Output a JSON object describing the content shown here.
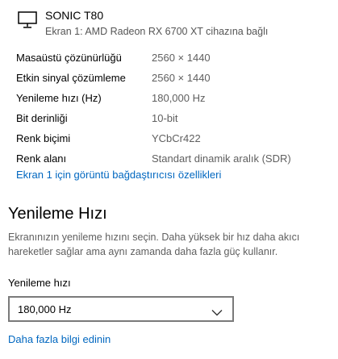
{
  "display": {
    "icon": "monitor-icon",
    "name": "SONIC T80",
    "subtitle": "Ekran 1: AMD Radeon RX 6700 XT cihazına bağlı"
  },
  "info_rows": [
    {
      "label": "Masaüstü çözünürlüğü",
      "value": "2560 × 1440"
    },
    {
      "label": "Etkin sinyal çözümleme",
      "value": "2560 × 1440"
    },
    {
      "label": "Yenileme hızı (Hz)",
      "value": "180,000 Hz"
    },
    {
      "label": "Bit derinliği",
      "value": "10-bit"
    },
    {
      "label": "Renk biçimi",
      "value": "YCbCr422"
    },
    {
      "label": "Renk alanı",
      "value": "Standart dinamik aralık (SDR)"
    }
  ],
  "adapter_link": "Ekran 1 için görüntü bağdaştırıcısı özellikleri",
  "refresh_section": {
    "title": "Yenileme Hızı",
    "description": "Ekranınızın yenileme hızını seçin. Daha yüksek bir hız daha akıcı hareketler sağlar ama aynı zamanda daha fazla güç kullanır.",
    "field_label": "Yenileme hızı",
    "selected_value": "180,000 Hz",
    "dropdown_icon": "chevron-down-icon",
    "more_info_link": "Daha fazla bilgi edinin"
  },
  "colors": {
    "link": "#0067c0",
    "secondary_text": "#5f5f5f",
    "dropdown_border": "#7a7a7a"
  }
}
